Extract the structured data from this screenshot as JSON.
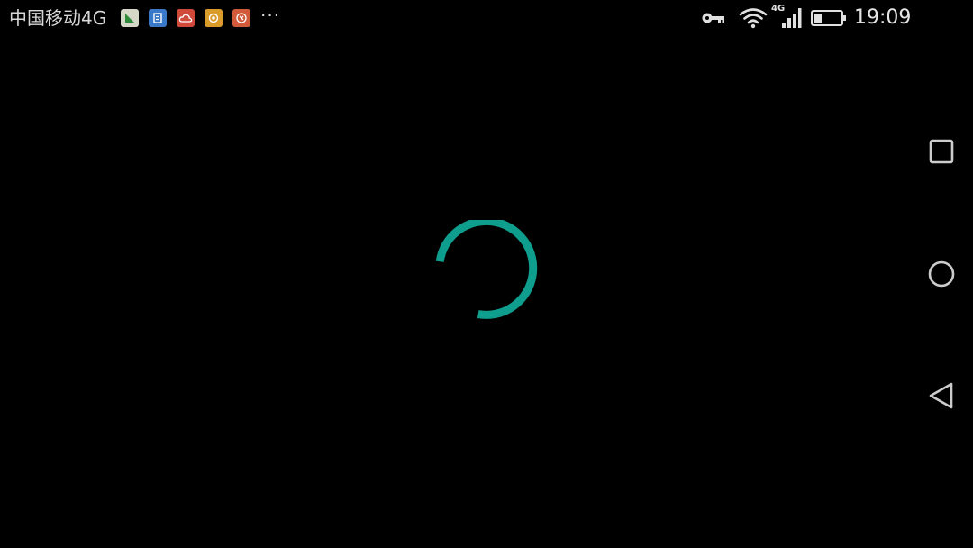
{
  "status_bar": {
    "carrier": "中国移动4G",
    "network_badge": "4G",
    "time": "19:09",
    "overflow": "···",
    "notification_icons": [
      {
        "name": "sheets-app-icon",
        "color": "#d7d7c8"
      },
      {
        "name": "document-app-icon",
        "color": "#3a78c8"
      },
      {
        "name": "cloud-app-icon",
        "color": "#d04a3c"
      },
      {
        "name": "camera-app-icon",
        "color": "#d99b2a"
      },
      {
        "name": "browser-app-icon",
        "color": "#d05a3a"
      }
    ],
    "system_icons": [
      "vpn-key-icon",
      "wifi-icon",
      "signal-icon",
      "battery-icon"
    ]
  },
  "loader": {
    "icon": "loading-spinner",
    "color": "#0f9e8e"
  },
  "nav_bar": {
    "buttons": [
      "recent-apps-button",
      "home-button",
      "back-button"
    ]
  },
  "colors": {
    "background": "#000000",
    "status_text": "#d8d8d8",
    "nav_icons": "#cccccc",
    "accent": "#0f9e8e"
  }
}
